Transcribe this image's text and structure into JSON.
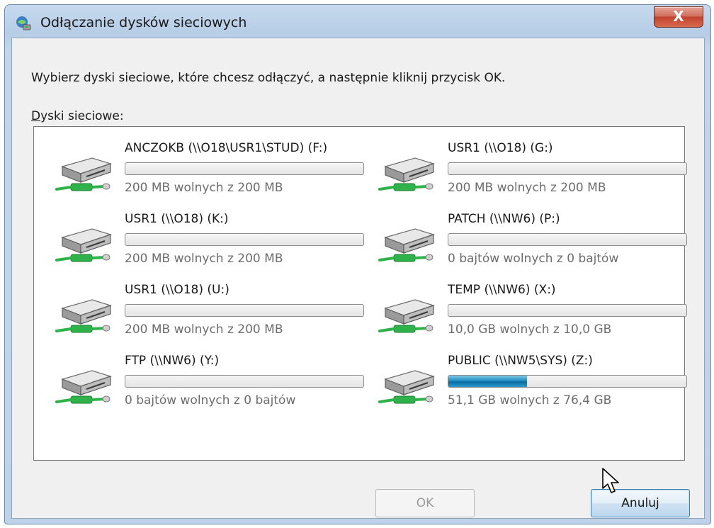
{
  "window": {
    "title": "Odłączanie dysków sieciowych",
    "close_label": "X"
  },
  "content": {
    "instruction": "Wybierz dyski sieciowe, które chcesz odłączyć, a następnie kliknij przycisk OK.",
    "list_label_accel": "D",
    "list_label_rest": "yski sieciowe:"
  },
  "drives": [
    {
      "name": "ANCZOKB (\\\\O18\\USR1\\STUD) (F:)",
      "free": "200 MB wolnych z 200 MB",
      "used_fraction": 0
    },
    {
      "name": "USR1 (\\\\O18) (G:)",
      "free": "200 MB wolnych z 200 MB",
      "used_fraction": 0
    },
    {
      "name": "USR1 (\\\\O18) (K:)",
      "free": "200 MB wolnych z 200 MB",
      "used_fraction": 0
    },
    {
      "name": "PATCH (\\\\NW6) (P:)",
      "free": "0 bajtów wolnych z 0 bajtów",
      "used_fraction": 0
    },
    {
      "name": "USR1 (\\\\O18) (U:)",
      "free": "200 MB wolnych z 200 MB",
      "used_fraction": 0
    },
    {
      "name": "TEMP (\\\\NW6) (X:)",
      "free": "10,0 GB wolnych z 10,0 GB",
      "used_fraction": 0
    },
    {
      "name": "FTP (\\\\NW6) (Y:)",
      "free": "0 bajtów wolnych z 0 bajtów",
      "used_fraction": 0
    },
    {
      "name": "PUBLIC (\\\\NW5\\SYS) (Z:)",
      "free": "51,1 GB wolnych z 76,4 GB",
      "used_fraction": 0.331
    }
  ],
  "buttons": {
    "ok_label": "OK",
    "cancel_label": "Anuluj"
  },
  "icons": {
    "title": "network-drive-icon",
    "drive": "network-drive-icon",
    "cursor": "mouse-cursor-icon"
  },
  "colors": {
    "bar_fill": "#1f8fc4",
    "accent_green": "#2fb24a",
    "close_red": "#c2432d"
  }
}
